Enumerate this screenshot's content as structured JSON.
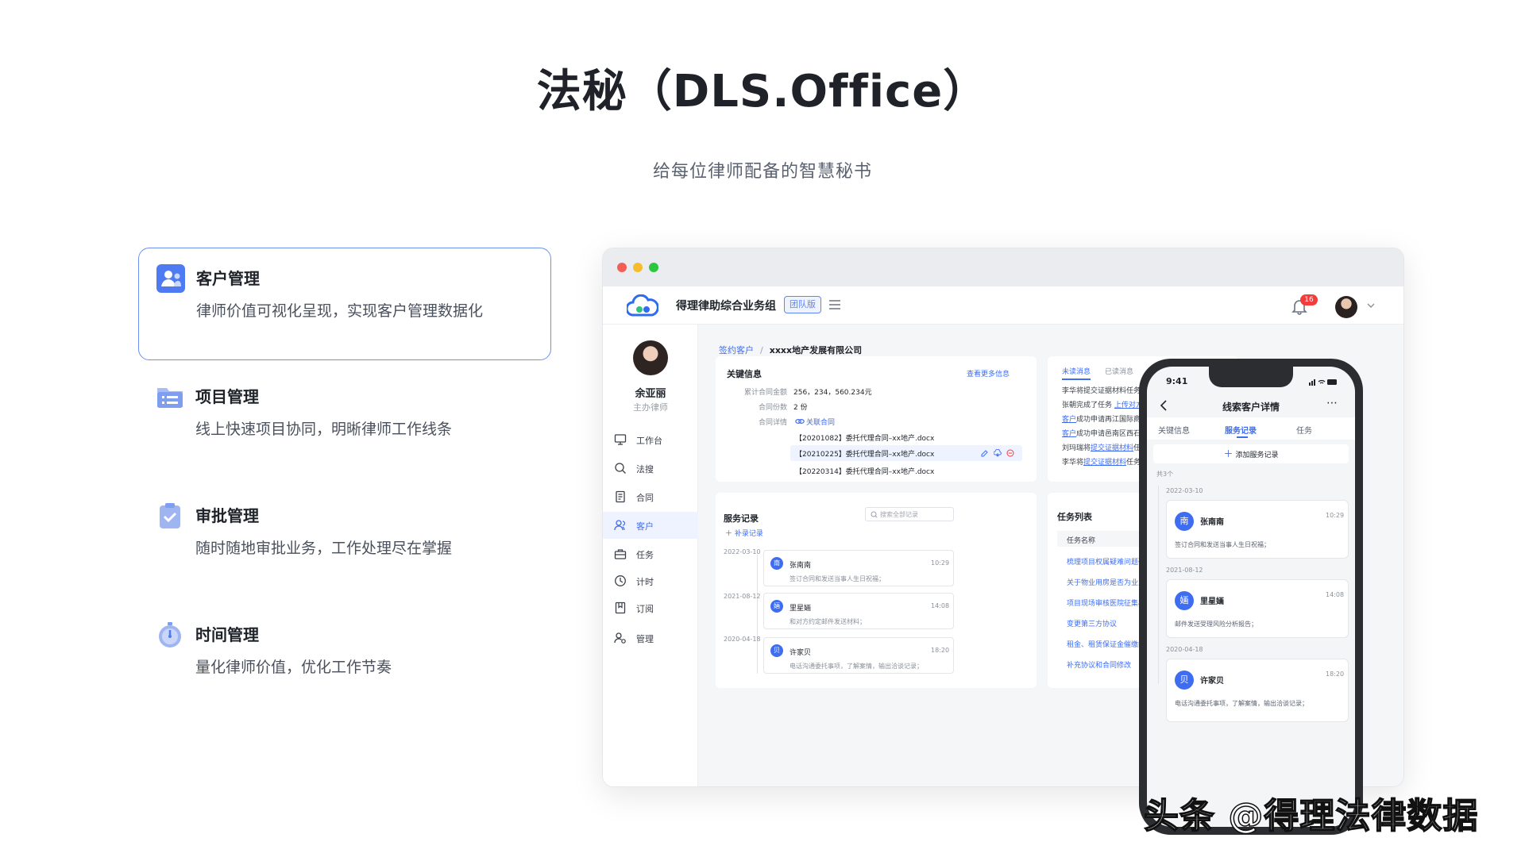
{
  "hero": {
    "title": "法秘（DLS.Office）",
    "subtitle": "给每位律师配备的智慧秘书"
  },
  "features": [
    {
      "title": "客户管理",
      "desc": "律师价值可视化呈现，实现客户管理数据化",
      "icon": "client-icon",
      "active": true
    },
    {
      "title": "项目管理",
      "desc": "线上快速项目协同，明晰律师工作线条",
      "icon": "folder-list-icon"
    },
    {
      "title": "审批管理",
      "desc": "随时随地审批业务，工作处理尽在掌握",
      "icon": "clipboard-check-icon"
    },
    {
      "title": "时间管理",
      "desc": "量化律师价值，优化工作节奏",
      "icon": "stopwatch-icon"
    }
  ],
  "app": {
    "name": "得理律助综合业务组",
    "edition": "团队版",
    "notifications": "16",
    "colors": {
      "accent": "#3e6df2",
      "badge": "#f23d3d"
    }
  },
  "profile": {
    "name": "余亚丽",
    "role": "主办律师"
  },
  "nav": [
    {
      "label": "工作台",
      "icon": "monitor-icon"
    },
    {
      "label": "法搜",
      "icon": "search-icon"
    },
    {
      "label": "合同",
      "icon": "document-icon"
    },
    {
      "label": "客户",
      "icon": "users-icon",
      "active": true
    },
    {
      "label": "任务",
      "icon": "briefcase-icon"
    },
    {
      "label": "计时",
      "icon": "clock-icon"
    },
    {
      "label": "订阅",
      "icon": "bookmark-icon"
    },
    {
      "label": "管理",
      "icon": "user-gear-icon"
    }
  ],
  "breadcrumb": {
    "link": "签约客户",
    "sep": "/",
    "current": "xxxx地产发展有限公司"
  },
  "key_info": {
    "title": "关键信息",
    "more": "查看更多信息",
    "rows": [
      {
        "label": "累计合同金额",
        "value": "256，234，560.234元"
      },
      {
        "label": "合同份数",
        "value": "2 份"
      },
      {
        "label": "合同详情",
        "value": "关联合同"
      }
    ],
    "files": [
      "【20201082】委托代理合同–xx地产.docx",
      "【20210225】委托代理合同–xx地产.docx",
      "【20220314】委托代理合同–xx地产.docx"
    ]
  },
  "messages": {
    "tabs": [
      "未读消息",
      "已读消息"
    ],
    "items": [
      {
        "pre": "李华将提交证据材料任务分配",
        "link": "",
        "post": ""
      },
      {
        "pre": "张朝完成了任务 ",
        "link": "上传对方当",
        "post": ""
      },
      {
        "pre": "",
        "link": "客户",
        "post": "成功申请再江国际商务中"
      },
      {
        "pre": "",
        "link": "客户",
        "post": "成功申请邑南区西石循园"
      },
      {
        "pre": "刘玛瑞将",
        "link": "提交证据材料",
        "post": "任务分"
      },
      {
        "pre": "李华将",
        "link": "提交证据材料",
        "post": "任务分配"
      }
    ]
  },
  "service": {
    "title": "服务记录",
    "search_placeholder": "搜索全部记录",
    "add": "补录记录",
    "records": [
      {
        "date": "2022-03-10",
        "avatar": "南",
        "name": "张南南",
        "time": "10:29",
        "text": "签订合同和发送当事人生日祝福；"
      },
      {
        "date": "2021-08-12",
        "avatar": "婳",
        "name": "里星婳",
        "time": "14:08",
        "text": "和对方约定邮件发送材料；"
      },
      {
        "date": "2020-04-18",
        "avatar": "贝",
        "name": "许家贝",
        "time": "18:20",
        "text": "电话沟通委托事项，了解案情，输出洽谈记录；"
      }
    ]
  },
  "tasks": {
    "title": "任务列表",
    "column": "任务名称",
    "items": [
      "梳理项目权属疑难问题研究",
      "关于物业用房是否为业主共",
      "项目现场审核医院征集材料",
      "变更第三方协议",
      "租金、租赁保证金催缴函件",
      "补充协议和合同修改"
    ]
  },
  "mobile": {
    "time": "9:41",
    "title": "线索客户详情",
    "tabs": [
      "关键信息",
      "服务记录",
      "任务"
    ],
    "add": "添加服务记录",
    "count": "共3个",
    "records": [
      {
        "date": "2022-03-10",
        "avatar": "南",
        "name": "张南南",
        "time": "10:29",
        "text": "签订合同和发送当事人生日祝福；"
      },
      {
        "date": "2021-08-12",
        "avatar": "婳",
        "name": "里星婳",
        "time": "14:08",
        "text": "邮件发送受理风险分析报告；"
      },
      {
        "date": "2020-04-18",
        "avatar": "贝",
        "name": "许家贝",
        "time": "18:20",
        "text": "电话沟通委托事项，了解案情，输出洽谈记录；"
      }
    ]
  },
  "watermark": "头条 @得理法律数据"
}
